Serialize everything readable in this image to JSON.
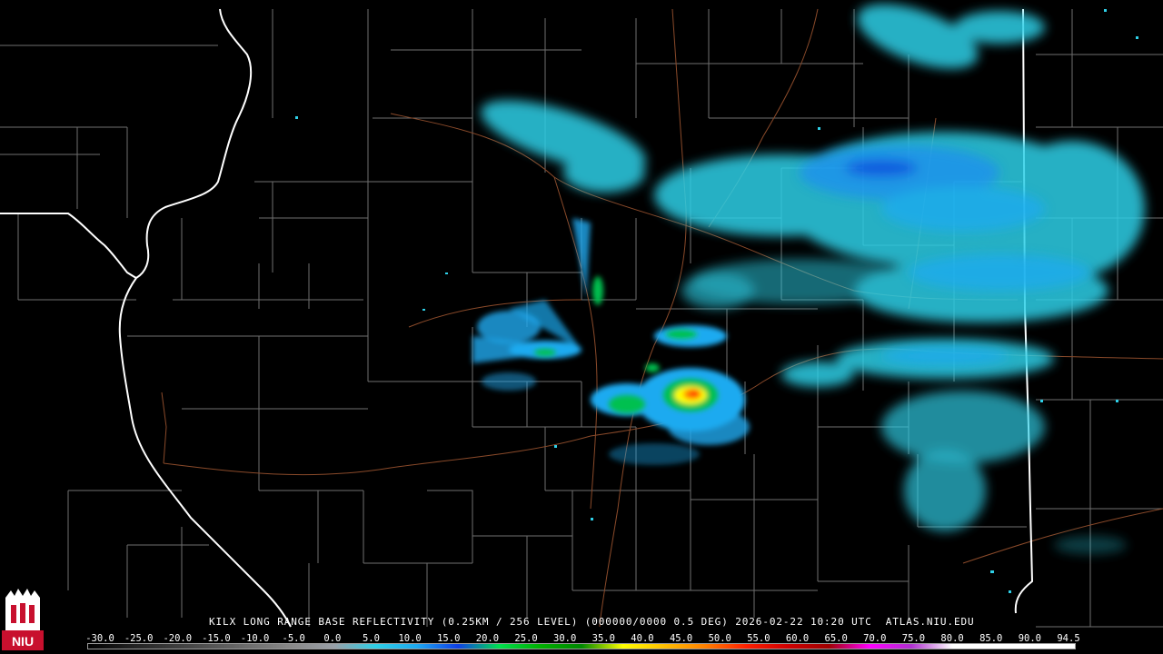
{
  "product": {
    "title": "KILX LONG RANGE BASE REFLECTIVITY (0.25KM / 256 LEVEL) (000000/0000 0.5 DEG) 2026-02-22 10:20 UTC  ATLAS.NIU.EDU"
  },
  "logo": {
    "text": "NIU",
    "primary_color": "#c8102e",
    "secondary_color": "#ffffff"
  },
  "colors": {
    "background": "#000000",
    "county_lines": "#6f6f6f",
    "state_lines": "#ffffff",
    "roads": "#8a4a2a"
  },
  "legend": {
    "ticks": [
      "-30.0",
      "-25.0",
      "-20.0",
      "-15.0",
      "-10.0",
      "-5.0",
      "0.0",
      "5.0",
      "10.0",
      "15.0",
      "20.0",
      "25.0",
      "30.0",
      "35.0",
      "40.0",
      "45.0",
      "50.0",
      "55.0",
      "60.0",
      "65.0",
      "70.0",
      "75.0",
      "80.0",
      "85.0",
      "90.0",
      "94.5"
    ],
    "color_stops": [
      "#000000",
      "#202020",
      "#3a3a3a",
      "#555555",
      "#707070",
      "#8a8a8a",
      "#9aa0a8",
      "#2fd0e8",
      "#1eaaf0",
      "#1040e8",
      "#00e050",
      "#00b000",
      "#008800",
      "#ffff00",
      "#ffc000",
      "#ff8000",
      "#ff2000",
      "#d00000",
      "#a00000",
      "#ff00ff",
      "#b030d0",
      "#ffffff",
      "#ffffff",
      "#ffffff",
      "#ffffff"
    ]
  },
  "echo_colors": {
    "light": "#2fd0e8",
    "medium": "#1eaaf0",
    "heavy": "#1040e8",
    "green": "#00c050",
    "yellow": "#ffff00",
    "orange": "#ff8000",
    "red": "#ff2000"
  }
}
